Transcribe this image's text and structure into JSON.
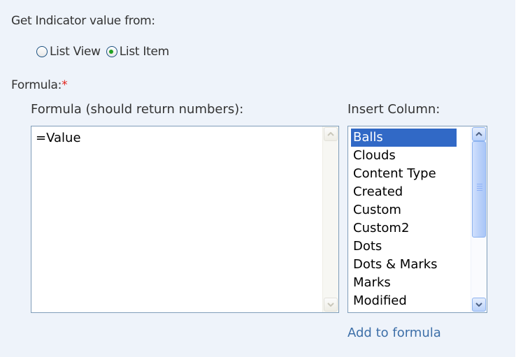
{
  "indicator_source": {
    "label": "Get Indicator value from:",
    "options": [
      {
        "label": "List View",
        "selected": false
      },
      {
        "label": "List Item",
        "selected": true
      }
    ]
  },
  "formula": {
    "label": "Formula:",
    "required_marker": "*",
    "editor_header": "Formula (should return numbers):",
    "editor_value": "=Value",
    "insert_column_header": "Insert Column:",
    "columns": [
      "Balls",
      "Clouds",
      "Content Type",
      "Created",
      "Custom",
      "Custom2",
      "Dots",
      "Dots & Marks",
      "Marks",
      "Modified"
    ],
    "selected_column": "Balls",
    "add_link": "Add to formula"
  },
  "colors": {
    "panel_background": "#eef3fa",
    "selection": "#3169c6",
    "link": "#3d6fa8",
    "required": "#e2231a"
  },
  "icons": [
    "radio-unselected-icon",
    "radio-selected-icon",
    "scroll-up-arrow-icon",
    "scroll-down-arrow-icon"
  ]
}
